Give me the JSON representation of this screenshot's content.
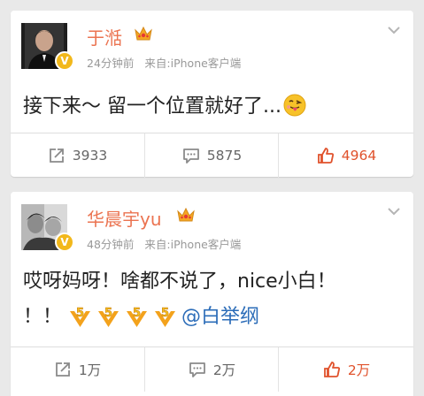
{
  "posts": [
    {
      "username": "于湉",
      "time": "24分钟前",
      "source": "来自:iPhone客户端",
      "verified_badge": "V",
      "content_lines": [
        "接下来～ 留一个位置就好了..."
      ],
      "emoji": "tongue-out-emoji",
      "actions": {
        "repost": "3933",
        "comment": "5875",
        "like": "4964"
      }
    },
    {
      "username": "华晨宇yu",
      "time": "48分钟前",
      "source": "来自:iPhone客户端",
      "verified_badge": "V",
      "content_lines": [
        "哎呀妈呀！啥都不说了，nice小白！",
        "！！"
      ],
      "level_badge": "5",
      "mention": "@白举纲",
      "actions": {
        "repost": "1万",
        "comment": "2万",
        "like": "2万"
      }
    }
  ],
  "colors": {
    "username": "#eb7350",
    "mention": "#2b6cb8",
    "like_active": "#e0522c",
    "crown": "#f5a623",
    "badge": "#f2b81b"
  }
}
